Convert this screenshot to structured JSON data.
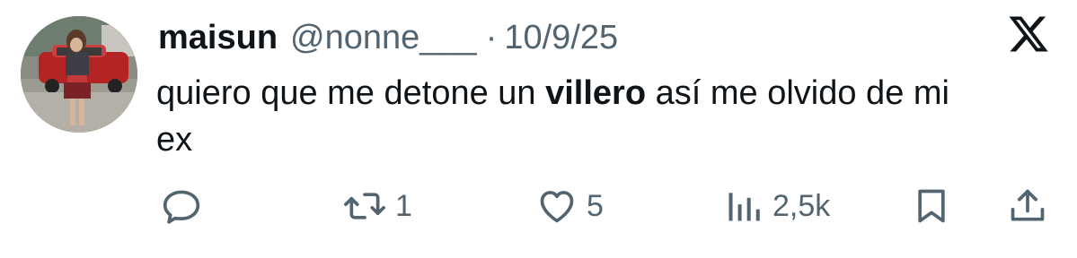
{
  "tweet": {
    "display_name": "maisun",
    "handle": "@nonne___",
    "separator": "·",
    "date": "10/9/25",
    "text_before": "quiero que me detone un ",
    "text_bold": "villero",
    "text_after": " así me olvido de mi ex"
  },
  "actions": {
    "reply": {
      "icon": "reply-icon",
      "count": ""
    },
    "retweet": {
      "icon": "retweet-icon",
      "count": "1"
    },
    "like": {
      "icon": "heart-icon",
      "count": "5"
    },
    "views": {
      "icon": "views-bar-chart-icon",
      "count": "2,5k"
    },
    "bookmark": {
      "icon": "bookmark-icon"
    },
    "share": {
      "icon": "share-icon"
    }
  },
  "branding": {
    "logo": "x-logo-icon"
  },
  "colors": {
    "text": "#0f1419",
    "secondary": "#536471",
    "background": "#ffffff"
  }
}
